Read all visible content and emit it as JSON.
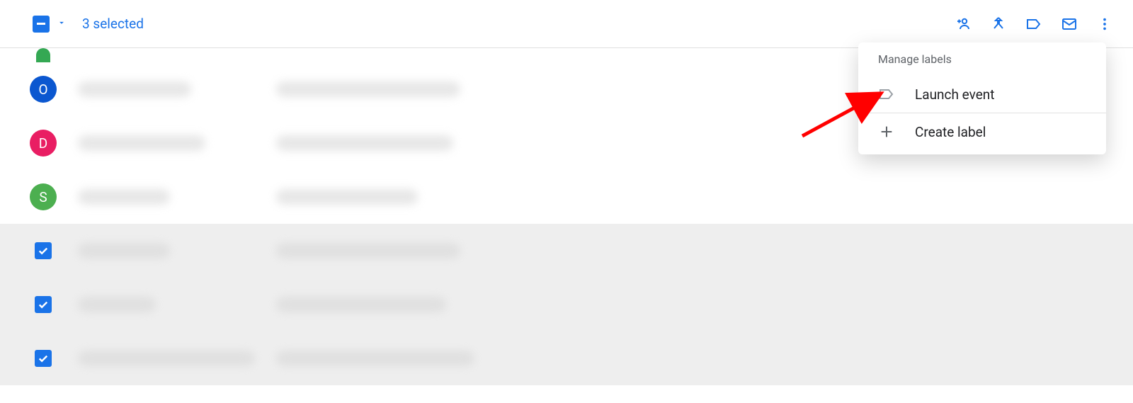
{
  "toolbar": {
    "selection_text": "3 selected",
    "actions": {
      "add_person": "Add to contacts",
      "merge": "Merge",
      "label": "Manage labels",
      "email": "Send email",
      "more": "More actions"
    }
  },
  "list": {
    "rows": [
      {
        "type": "partial",
        "avatar_letter": "",
        "avatar_color": "#34a853",
        "selected": false
      },
      {
        "type": "avatar",
        "avatar_letter": "O",
        "avatar_color": "#0b57d0",
        "selected": false
      },
      {
        "type": "avatar",
        "avatar_letter": "D",
        "avatar_color": "#e91e63",
        "selected": false
      },
      {
        "type": "avatar",
        "avatar_letter": "S",
        "avatar_color": "#4caf50",
        "selected": false
      },
      {
        "type": "checkbox",
        "avatar_letter": "",
        "avatar_color": "",
        "selected": true
      },
      {
        "type": "checkbox",
        "avatar_letter": "",
        "avatar_color": "",
        "selected": true
      },
      {
        "type": "checkbox",
        "avatar_letter": "",
        "avatar_color": "",
        "selected": true
      }
    ]
  },
  "menu": {
    "header": "Manage labels",
    "items": [
      {
        "label": "Launch event",
        "icon": "label-outline"
      },
      {
        "label": "Create label",
        "icon": "plus"
      }
    ]
  }
}
